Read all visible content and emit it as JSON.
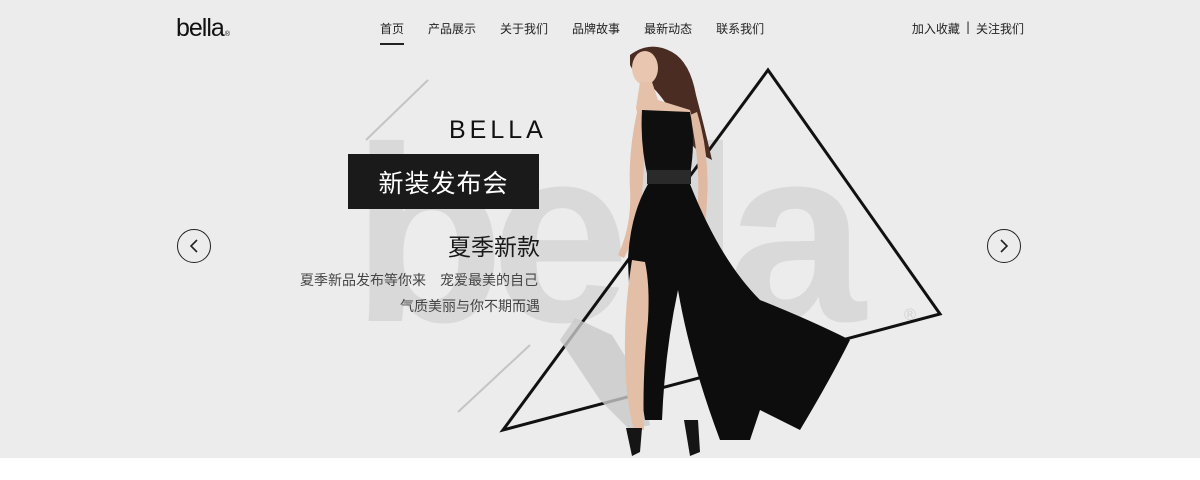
{
  "header": {
    "logo_text": "bella",
    "logo_mark": "®",
    "nav": [
      "首页",
      "产品展示",
      "关于我们",
      "品牌故事",
      "最新动态",
      "联系我们"
    ],
    "active_index": 0,
    "links": {
      "favorite": "加入收藏",
      "separator": "|",
      "follow": "关注我们"
    }
  },
  "banner": {
    "watermark_text": "bella",
    "watermark_mark": "®",
    "brand": "BELLA",
    "title": "新装发布会",
    "subtitle": "夏季新款",
    "desc_line1": "夏季新品发布等你来　宠爱最美的自己",
    "desc_line2": "气质美丽与你不期而遇",
    "prev_icon": "chevron-left-icon",
    "next_icon": "chevron-right-icon"
  },
  "colors": {
    "background": "#ececec",
    "text_dark": "#1a1a1a",
    "watermark": "#d9d9d9",
    "dress": "#0d0d0d"
  }
}
